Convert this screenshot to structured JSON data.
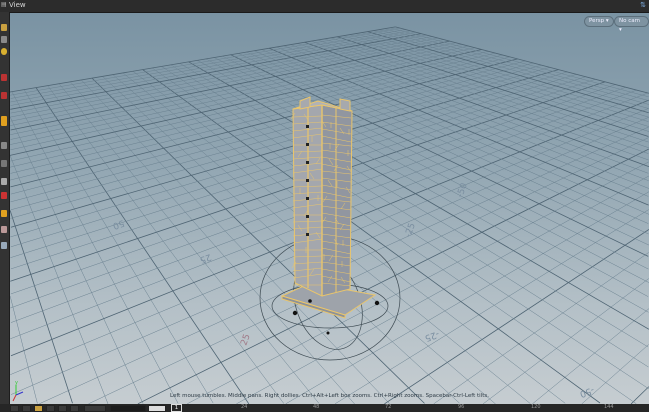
{
  "header": {
    "title": "View"
  },
  "viewport": {
    "camera_menu": "Persp ▾",
    "cam_menu": "No cam ▾",
    "status": "Left mouse tumbles. Middle pans. Right dollies. Ctrl+Alt+Left box zooms. Ctrl+Right zooms. Spacebar-Ctrl-Left tilts.",
    "grid_labels": [
      "50",
      "25",
      "25",
      "-25",
      "-25",
      "-50",
      "-50"
    ],
    "axes": {
      "x": "x",
      "y": "y",
      "z": "z"
    }
  },
  "timeline": {
    "current_frame": "1",
    "ticks": [
      "24",
      "48",
      "72",
      "96",
      "120",
      "144"
    ]
  },
  "colors": {
    "geometry_wire": "#e9c56c",
    "grid": "#5f7685",
    "accent": "#e0a020"
  }
}
